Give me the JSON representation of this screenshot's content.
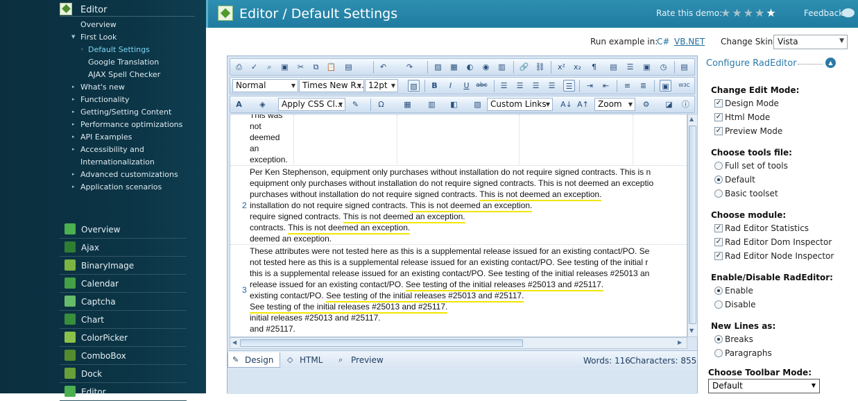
{
  "nav": {
    "product": "Editor",
    "tree": [
      {
        "label": "Overview",
        "arrow": ""
      },
      {
        "label": "First Look",
        "arrow": "▼"
      },
      {
        "label": "Default Settings",
        "arrow": "›"
      },
      {
        "label": "Google Translation",
        "arrow": ""
      },
      {
        "label": "AJAX Spell Checker",
        "arrow": ""
      },
      {
        "label": "What's new",
        "arrow": "▸"
      },
      {
        "label": "Functionality",
        "arrow": "▸"
      },
      {
        "label": "Getting/Setting Content",
        "arrow": "▸"
      },
      {
        "label": "Performance optimizations",
        "arrow": "▸"
      },
      {
        "label": "API Examples",
        "arrow": "▸"
      },
      {
        "label": "Accessibility and",
        "arrow": "▸"
      },
      {
        "label": "Internationalization",
        "arrow": ""
      },
      {
        "label": "Advanced customizations",
        "arrow": "▸"
      },
      {
        "label": "Application scenarios",
        "arrow": "▸"
      }
    ],
    "products": [
      {
        "label": "Overview",
        "icon": "overview-icon",
        "color": "#4caf50"
      },
      {
        "label": "Ajax",
        "icon": "ajax-icon",
        "color": "#2e7d32"
      },
      {
        "label": "BinaryImage",
        "icon": "binaryimage-icon",
        "color": "#7cb342"
      },
      {
        "label": "Calendar",
        "icon": "calendar-icon",
        "color": "#43a047"
      },
      {
        "label": "Captcha",
        "icon": "captcha-icon",
        "color": "#66bb6a"
      },
      {
        "label": "Chart",
        "icon": "chart-icon",
        "color": "#388e3c"
      },
      {
        "label": "ColorPicker",
        "icon": "colorpicker-icon",
        "color": "#8bc34a"
      },
      {
        "label": "ComboBox",
        "icon": "combobox-icon",
        "color": "#558b2f"
      },
      {
        "label": "Dock",
        "icon": "dock-icon",
        "color": "#689f38"
      },
      {
        "label": "Editor",
        "icon": "editor-icon",
        "color": "#4caf50"
      }
    ]
  },
  "header": {
    "title": "Editor / Default Settings",
    "rate_label": "Rate this demo:",
    "stars_total": 5,
    "stars_highlighted": 1,
    "feedback_label": "Feedback"
  },
  "run_example": {
    "label": "Run example in:",
    "csharp": "C#",
    "vbnet": "VB.NET",
    "skin_label": "Change Skin:",
    "skin_value": "Vista"
  },
  "toolbar": {
    "format_block": "Normal",
    "font_name": "Times New R...",
    "font_size": "12pt",
    "css_class": "Apply CSS Cl...",
    "custom_links": "Custom Links",
    "zoom": "Zoom"
  },
  "content": {
    "row1_lines": [
      "This was",
      "not",
      "deemed",
      "an",
      "exception."
    ],
    "row2_number": "2",
    "row2_lines": [
      {
        "pre": "Per Ken Stephenson, equipment only purchases without installation do not require signed contracts. This is n",
        "mark": ""
      },
      {
        "pre": "equipment only purchases without installation do not require signed contracts. This is not deemed an exceptio",
        "mark": ""
      },
      {
        "pre": "purchases without installation do not require signed contracts. ",
        "mark": "This is not deemed an exception."
      },
      {
        "pre": "installation do not require signed contracts. ",
        "mark": "This is not deemed an exception."
      },
      {
        "pre": "require signed contracts. ",
        "mark": "This is not deemed an exception."
      },
      {
        "pre": "contracts. ",
        "mark": "This is not deemed an exception."
      },
      {
        "pre": "deemed an exception.",
        "mark": ""
      }
    ],
    "row3_number": "3",
    "row3_lines": [
      {
        "pre": "These attributes were not tested here as this is a supplemental release issued for an existing contact/PO. Se",
        "mark": ""
      },
      {
        "pre": "not tested here as this is a supplemental release issued for an existing contact/PO. See testing of the initial r",
        "mark": ""
      },
      {
        "pre": "this is a supplemental release issued for an existing contact/PO. See testing of the initial releases #25013 an",
        "mark": ""
      },
      {
        "pre": "release issued for an existing contact/PO. ",
        "mark": "See testing of the initial releases #25013 and #25117."
      },
      {
        "pre": "existing contact/PO. ",
        "mark": "See testing of the initial releases #25013 and #25117."
      },
      {
        "pre": "",
        "mark": "See testing of the initial releases #25013 and #25117."
      },
      {
        "pre": "initial releases #25013 and #25117.",
        "mark": ""
      },
      {
        "pre": "and #25117.",
        "mark": ""
      }
    ]
  },
  "modes": {
    "design": "Design",
    "html": "HTML",
    "preview": "Preview",
    "words": "Words: 116",
    "characters": "Characters: 855"
  },
  "config": {
    "title": "Configure RadEditor",
    "groups": [
      {
        "title": "Change Edit Mode:",
        "type": "checkbox",
        "options": [
          {
            "label": "Design Mode",
            "checked": true
          },
          {
            "label": "Html Mode",
            "checked": true
          },
          {
            "label": "Preview Mode",
            "checked": true
          }
        ]
      },
      {
        "title": "Choose tools file:",
        "type": "radio",
        "options": [
          {
            "label": "Full set of tools",
            "checked": false
          },
          {
            "label": "Default",
            "checked": true
          },
          {
            "label": "Basic toolset",
            "checked": false
          }
        ]
      },
      {
        "title": "Choose module:",
        "type": "checkbox",
        "options": [
          {
            "label": "Rad Editor Statistics",
            "checked": true
          },
          {
            "label": "Rad Editor Dom Inspector",
            "checked": true
          },
          {
            "label": "Rad Editor Node Inspector",
            "checked": true
          }
        ]
      },
      {
        "title": "Enable/Disable RadEditor:",
        "type": "radio",
        "options": [
          {
            "label": "Enable",
            "checked": true
          },
          {
            "label": "Disable",
            "checked": false
          }
        ]
      },
      {
        "title": "New Lines as:",
        "type": "radio",
        "options": [
          {
            "label": "Breaks",
            "checked": true
          },
          {
            "label": "Paragraphs",
            "checked": false
          }
        ]
      }
    ],
    "toolbar_mode_title": "Choose Toolbar Mode:",
    "toolbar_mode_value": "Default"
  },
  "colors": {
    "accent": "#1f7ba0",
    "highlight": "#f0e600",
    "link": "#1b6d9b"
  }
}
